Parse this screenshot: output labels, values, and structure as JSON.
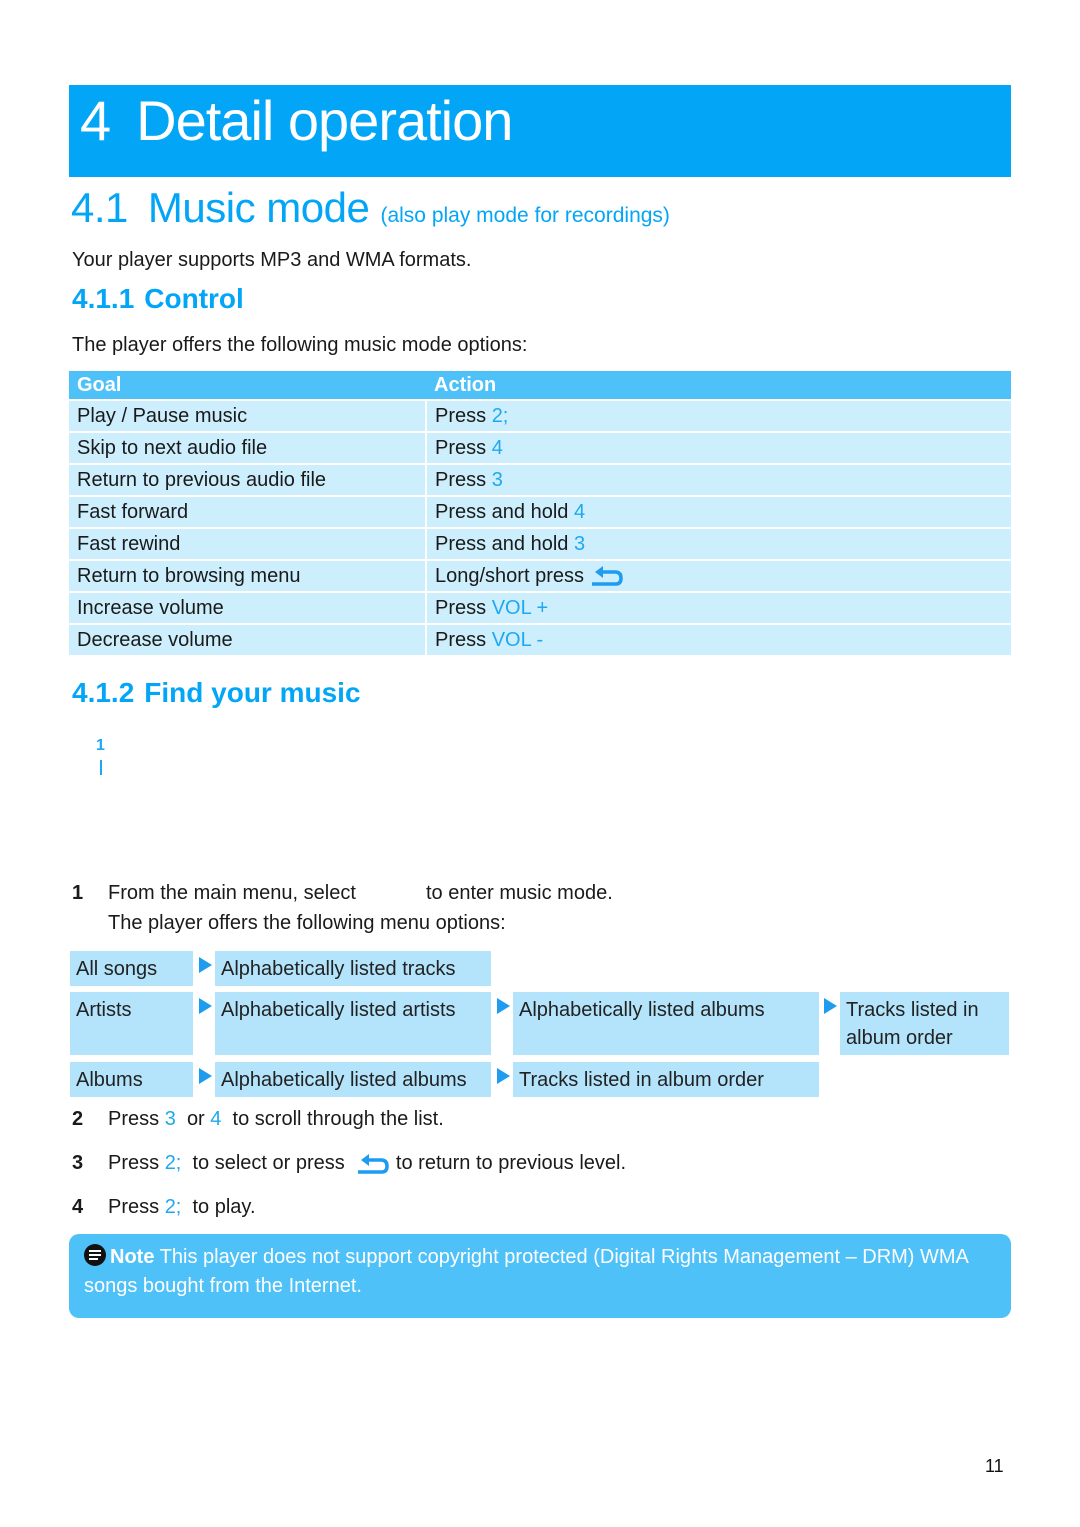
{
  "chapter": {
    "number": "4",
    "title": "Detail operation"
  },
  "section": {
    "number": "4.1",
    "title": "Music mode",
    "subtitle": "(also play mode for recordings)"
  },
  "intro": "Your player supports MP3 and WMA formats.",
  "control": {
    "number": "4.1.1",
    "title": "Control",
    "lead": "The player offers the following music mode options:",
    "headers": {
      "goal": "Goal",
      "action": "Action"
    },
    "rows": [
      {
        "goal": "Play / Pause music",
        "action": "Press",
        "key": "2;"
      },
      {
        "goal": "Skip to next audio file",
        "action": "Press",
        "key": "4"
      },
      {
        "goal": "Return to previous audio file",
        "action": "Press",
        "key": "3"
      },
      {
        "goal": "Fast forward",
        "action": "Press and hold",
        "key": "4"
      },
      {
        "goal": "Fast rewind",
        "action": "Press and hold",
        "key": "3"
      },
      {
        "goal": "Return to browsing menu",
        "action": "Long/short press",
        "key": "",
        "icon": "back-arrow-icon"
      },
      {
        "goal": "Increase volume",
        "action": "Press",
        "key": "VOL +"
      },
      {
        "goal": "Decrease volume",
        "action": "Press",
        "key": "VOL -"
      }
    ]
  },
  "find": {
    "number": "4.1.2",
    "title": "Find your music",
    "marks": {
      "one": "1"
    },
    "steps": [
      {
        "n": "1",
        "a": "From the main menu, select",
        "b": "to enter music mode.",
        "c": "The player offers the following menu options:"
      },
      {
        "n": "2",
        "a": "Press",
        "k1": "3",
        "or": "or",
        "k2": "4",
        "b": "to scroll through the list."
      },
      {
        "n": "3",
        "a": "Press",
        "k1": "2;",
        "b": "to select or press",
        "c": "to return to previous level."
      },
      {
        "n": "4",
        "a": "Press",
        "k1": "2;",
        "b": "to play."
      }
    ],
    "menu": {
      "all_songs": {
        "label": "All songs",
        "next": [
          "Alphabetically listed tracks"
        ]
      },
      "artists": {
        "label": "Artists",
        "next": [
          "Alphabetically listed artists",
          "Alphabetically listed albums",
          "Tracks listed in album order"
        ]
      },
      "albums": {
        "label": "Albums",
        "next": [
          "Alphabetically listed albums",
          "Tracks listed in album order"
        ]
      }
    }
  },
  "note": {
    "label": "Note",
    "text": "This player does not support copyright protected (Digital Rights Management – DRM) WMA songs bought from the Internet."
  },
  "page_number": "11",
  "colors": {
    "accent": "#03a6f7",
    "table_header": "#4fc1f9",
    "table_row": "#cdeefd",
    "menu_box": "#b3e4fb"
  }
}
